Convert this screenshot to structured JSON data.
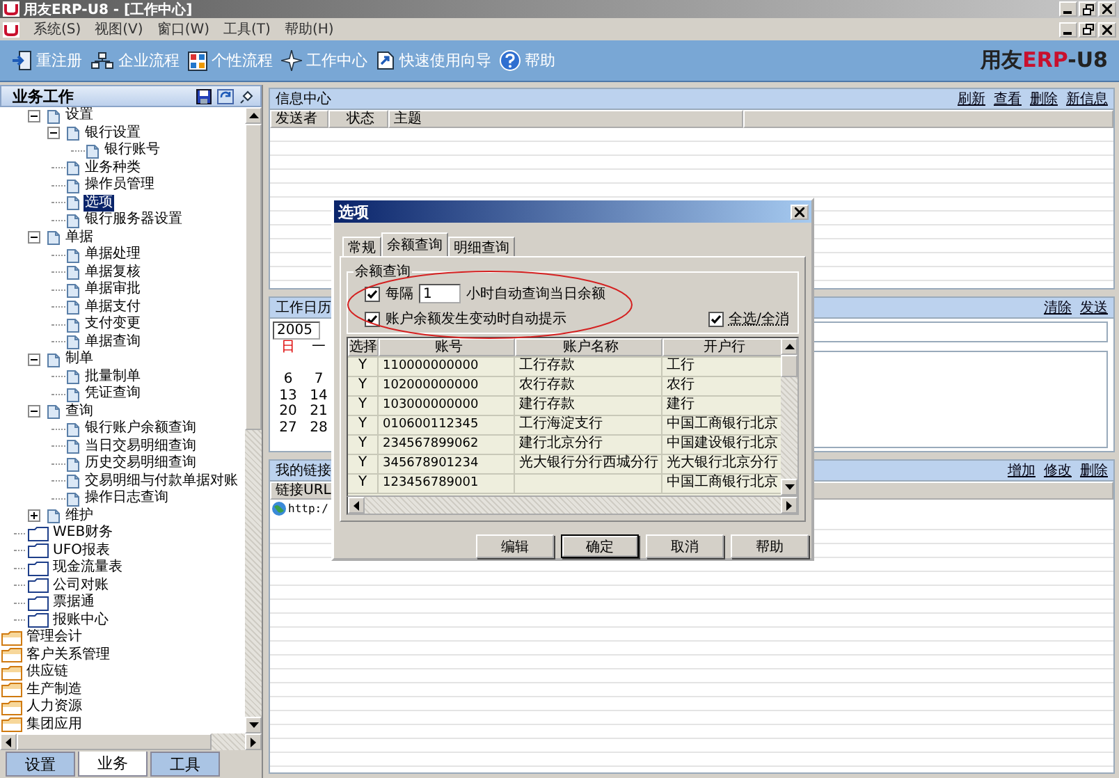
{
  "window": {
    "title": "用友ERP-U8 - [工作中心]"
  },
  "menu": [
    "系统(S)",
    "视图(V)",
    "窗口(W)",
    "工具(T)",
    "帮助(H)"
  ],
  "toolbar": [
    {
      "label": "重注册",
      "kind": "relogin"
    },
    {
      "label": "企业流程",
      "kind": "flow"
    },
    {
      "label": "个性流程",
      "kind": "custom"
    },
    {
      "label": "工作中心",
      "kind": "center"
    },
    {
      "label": "快速使用向导",
      "kind": "wizard"
    },
    {
      "label": "帮助",
      "kind": "help"
    }
  ],
  "brand": {
    "name": "用友",
    "mark": "ERP",
    "suffix": "-U8"
  },
  "sidebar": {
    "title": "业务工作",
    "tree": [
      {
        "label": "设置",
        "expanded": true,
        "selected": false,
        "children": [
          {
            "label": "银行设置",
            "expanded": true,
            "selected": false,
            "children": [
              {
                "label": "银行账号",
                "selected": false
              }
            ]
          },
          {
            "label": "业务种类",
            "selected": false
          },
          {
            "label": "操作员管理",
            "selected": false
          },
          {
            "label": "选项",
            "selected": true
          },
          {
            "label": "银行服务器设置",
            "selected": false
          }
        ]
      },
      {
        "label": "单据",
        "expanded": true,
        "selected": false,
        "children": [
          {
            "label": "单据处理",
            "selected": false
          },
          {
            "label": "单据复核",
            "selected": false
          },
          {
            "label": "单据审批",
            "selected": false
          },
          {
            "label": "单据支付",
            "selected": false
          },
          {
            "label": "支付变更",
            "selected": false
          },
          {
            "label": "单据查询",
            "selected": false
          }
        ]
      },
      {
        "label": "制单",
        "expanded": true,
        "selected": false,
        "children": [
          {
            "label": "批量制单",
            "selected": false
          },
          {
            "label": "凭证查询",
            "selected": false
          }
        ]
      },
      {
        "label": "查询",
        "expanded": true,
        "selected": false,
        "children": [
          {
            "label": "银行账户余额查询",
            "selected": false
          },
          {
            "label": "当日交易明细查询",
            "selected": false
          },
          {
            "label": "历史交易明细查询",
            "selected": false
          },
          {
            "label": "交易明细与付款单据对账",
            "selected": false
          },
          {
            "label": "操作日志查询",
            "selected": false
          }
        ]
      },
      {
        "label": "维护",
        "expanded": false,
        "selected": false
      }
    ],
    "folders": [
      {
        "label": "WEB财务",
        "selected": false
      },
      {
        "label": "UFO报表",
        "selected": false
      },
      {
        "label": "现金流量表",
        "selected": false
      },
      {
        "label": "公司对账",
        "selected": false
      },
      {
        "label": "票据通",
        "selected": false
      },
      {
        "label": "报账中心",
        "selected": false
      }
    ],
    "modules": [
      {
        "label": "管理会计",
        "selected": false
      },
      {
        "label": "客户关系管理",
        "selected": false
      },
      {
        "label": "供应链",
        "selected": false
      },
      {
        "label": "生产制造",
        "selected": false
      },
      {
        "label": "人力资源",
        "selected": false
      },
      {
        "label": "集团应用",
        "selected": false
      }
    ],
    "tabs": [
      {
        "label": "设置",
        "selected": false
      },
      {
        "label": "业务",
        "selected": true
      },
      {
        "label": "工具",
        "selected": false
      }
    ]
  },
  "info_center": {
    "title": "信息中心",
    "actions": [
      "刷新",
      "查看",
      "删除",
      "新信息"
    ],
    "columns": [
      "发送者",
      "状态",
      "主题"
    ]
  },
  "calendar": {
    "title": "工作日历",
    "actions": [
      "清除",
      "发送"
    ],
    "year": "2005",
    "weekdays": [
      "日",
      "一"
    ],
    "weeks": [
      [
        "6",
        "7"
      ],
      [
        "13",
        "14"
      ],
      [
        "20",
        "21"
      ],
      [
        "27",
        "28"
      ]
    ]
  },
  "links": {
    "title": "我的链接",
    "actions": [
      "增加",
      "修改",
      "删除"
    ],
    "columns": [
      "链接URL"
    ],
    "rows": [
      "http:/"
    ]
  },
  "dialog": {
    "title": "选项",
    "tabs": [
      {
        "label": "常规",
        "selected": false
      },
      {
        "label": "余额查询",
        "selected": true
      },
      {
        "label": "明细查询",
        "selected": false
      }
    ],
    "group": "余额查询",
    "interval": {
      "checked": true,
      "prefix": "每隔",
      "value": "1",
      "suffix": "小时自动查询当日余额"
    },
    "notify": {
      "checked": true,
      "label": "账户余额发生变动时自动提示"
    },
    "select_all": {
      "checked": true,
      "label": "全选/全消"
    },
    "columns": [
      "选择",
      "账号",
      "账户名称",
      "开户行"
    ],
    "rows": [
      {
        "select": "Y",
        "account": "110000000000",
        "name": "工行存款",
        "bank": "工行"
      },
      {
        "select": "Y",
        "account": "102000000000",
        "name": "农行存款",
        "bank": "农行"
      },
      {
        "select": "Y",
        "account": "103000000000",
        "name": "建行存款",
        "bank": "建行"
      },
      {
        "select": "Y",
        "account": "010600112345",
        "name": "工行海淀支行",
        "bank": "中国工商银行北京"
      },
      {
        "select": "Y",
        "account": "234567899062",
        "name": "建行北京分行",
        "bank": "中国建设银行北京"
      },
      {
        "select": "Y",
        "account": "345678901234",
        "name": "光大银行分行西城分行",
        "bank": "光大银行北京分行"
      },
      {
        "select": "Y",
        "account": "123456789001",
        "bank": "中国工商银行北京"
      }
    ],
    "buttons": [
      {
        "label": "编辑",
        "default": false
      },
      {
        "label": "确定",
        "default": true
      },
      {
        "label": "取消",
        "default": false
      },
      {
        "label": "帮助",
        "default": false
      }
    ]
  }
}
